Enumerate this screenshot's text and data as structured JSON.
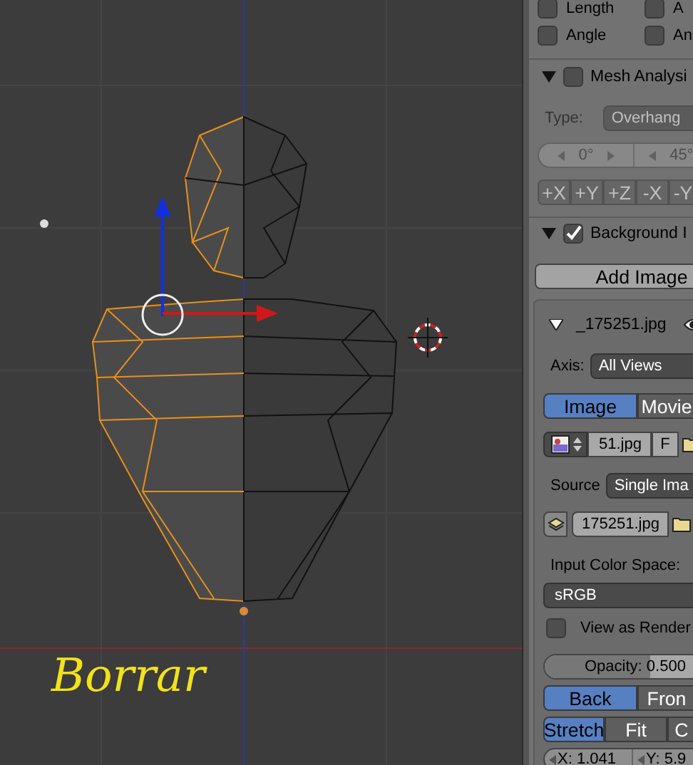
{
  "viewport": {
    "label": "Borrar"
  },
  "top_options": [
    {
      "label": "Length",
      "checked": false
    },
    {
      "label": "A",
      "checked": false
    },
    {
      "label": "Angle",
      "checked": false
    },
    {
      "label": "An",
      "checked": false
    }
  ],
  "mesh_analysis": {
    "label": "Mesh Analysi",
    "expanded": true,
    "checked": false,
    "disabled": true,
    "type_label": "Type:",
    "type_value": "Overhang",
    "range": [
      "0°",
      "45°"
    ],
    "axes": [
      {
        "label": "+X",
        "selected": false
      },
      {
        "label": "+Y",
        "selected": false
      },
      {
        "label": "+Z",
        "selected": false
      },
      {
        "label": "-X",
        "selected": false
      },
      {
        "label": "-Y",
        "selected": false
      }
    ]
  },
  "background_images": {
    "label": "Background I",
    "expanded": true,
    "checked": true,
    "add_button": "Add Image",
    "image": {
      "name": "_175251.jpg",
      "expanded": true,
      "axis_label": "Axis:",
      "axis_value": "All Views",
      "source_tabs": [
        {
          "label": "Image",
          "selected": true
        },
        {
          "label": "Movie",
          "selected": false
        }
      ],
      "file": "51.jpg",
      "file_flag": "F",
      "source_label": "Source",
      "source_value": "Single Ima",
      "image_name": "175251.jpg",
      "color_space_label": "Input Color Space:",
      "color_space": "sRGB",
      "view_as_render": {
        "label": "View as Render",
        "checked": false
      },
      "opacity": {
        "label": "Opacity:",
        "value": "0.500",
        "level": 0.5
      },
      "side_tabs": [
        {
          "label": "Back",
          "selected": true
        },
        {
          "label": "Fron",
          "selected": false
        }
      ],
      "fit_tabs": [
        {
          "label": "Stretch",
          "selected": true
        },
        {
          "label": "Fit",
          "selected": false
        },
        {
          "label": "C",
          "selected": false
        }
      ],
      "offset": [
        "X: 1.041",
        "Y: 5.9"
      ]
    }
  }
}
